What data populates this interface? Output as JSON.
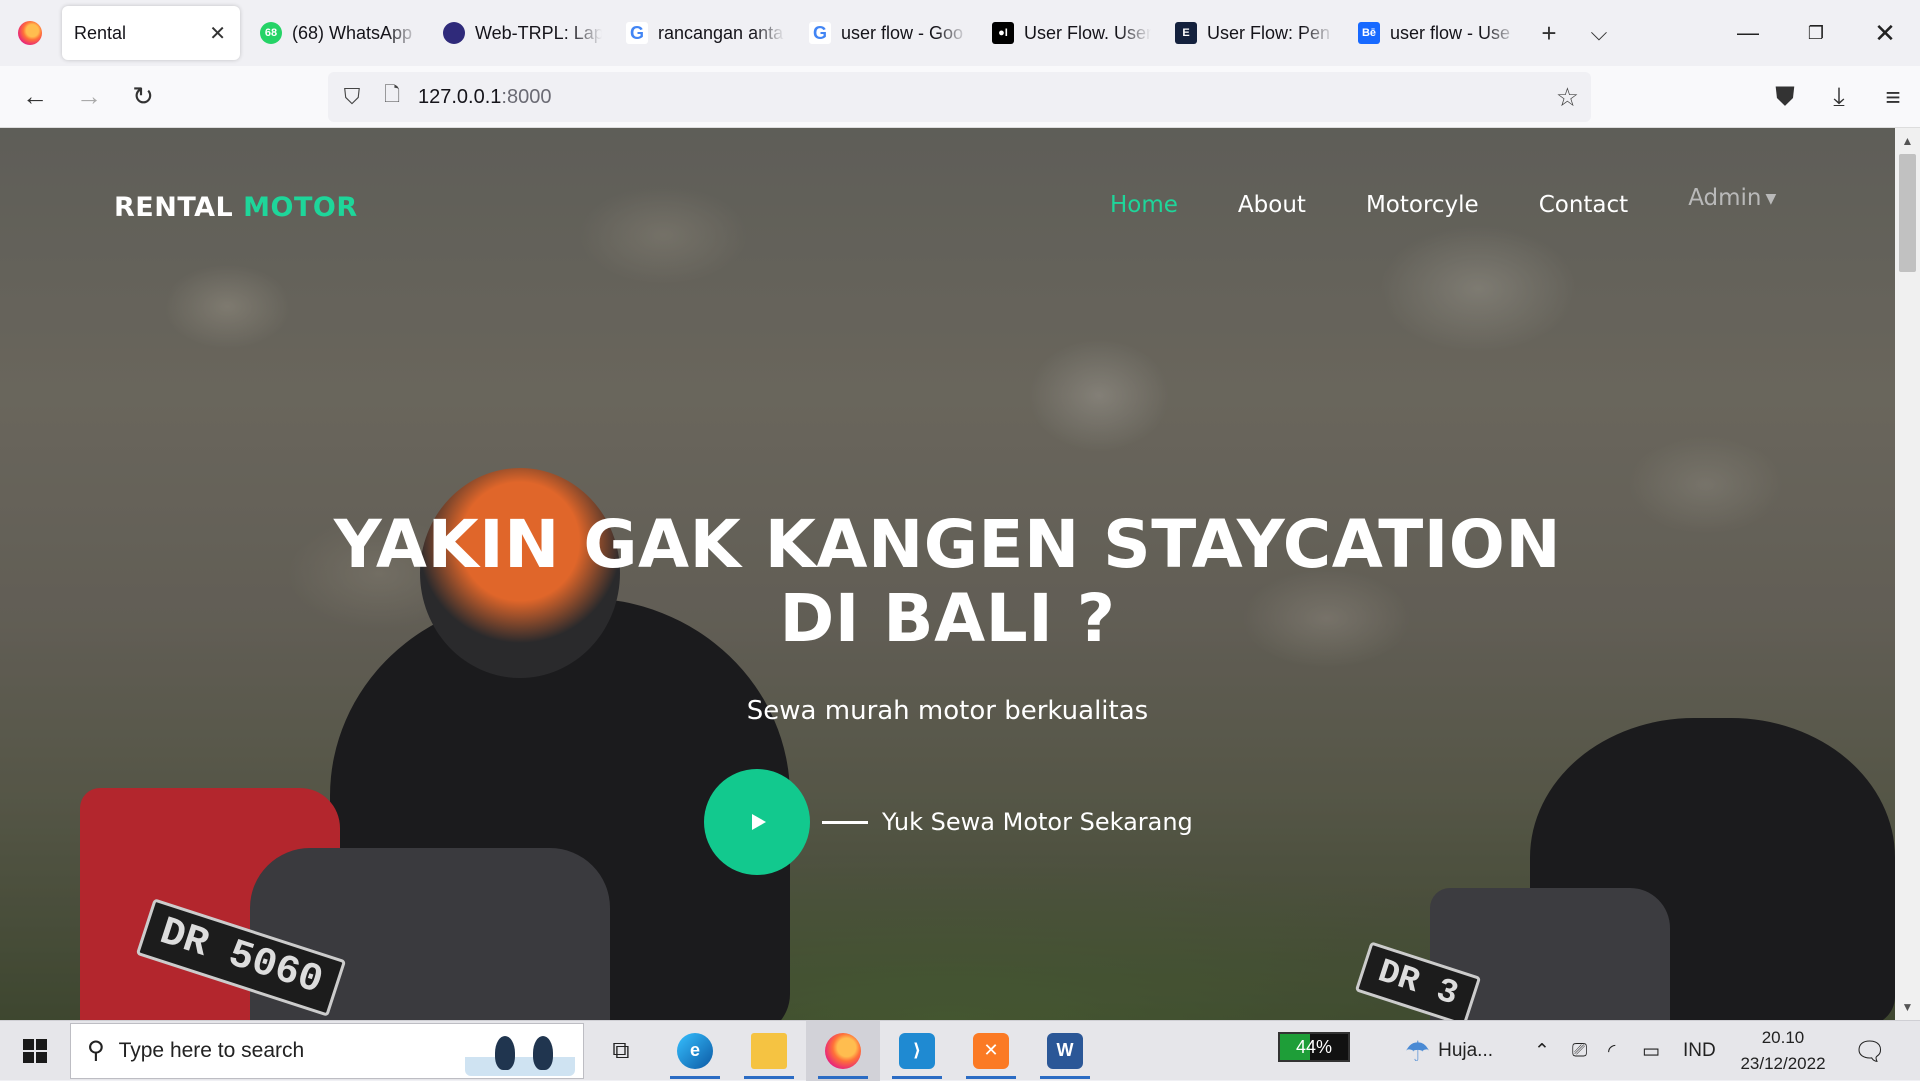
{
  "browser": {
    "tabs": [
      {
        "title": "Rental",
        "active": true,
        "favicon": "firefox-icon"
      },
      {
        "title": "(68) WhatsApp",
        "favicon_text": "68",
        "favicon_color": "#25d366"
      },
      {
        "title": "Web-TRPL: Lap",
        "favicon_text": "",
        "favicon_color": "#2f2a7a"
      },
      {
        "title": "rancangan anta",
        "favicon_text": "G",
        "favicon_color": "#4285f4"
      },
      {
        "title": "user flow - Goo",
        "favicon_text": "G",
        "favicon_color": "#4285f4"
      },
      {
        "title": "User Flow. User",
        "favicon_text": "M",
        "favicon_color": "#000000"
      },
      {
        "title": "User Flow: Pen",
        "favicon_text": "E",
        "favicon_color": "#14213d"
      },
      {
        "title": "user flow - Use",
        "favicon_text": "Bē",
        "favicon_color": "#1769ff"
      }
    ],
    "new_tab_icon": "plus-icon",
    "list_tabs_icon": "chevron-down-icon",
    "window_controls": [
      "minimize-icon",
      "restore-icon",
      "close-icon"
    ],
    "url_host": "127.0.0.1",
    "url_port": ":8000"
  },
  "site": {
    "brand_main": "RENTAL",
    "brand_accent": "MOTOR",
    "accent_color": "#1ed69a",
    "nav": {
      "home": "Home",
      "about": "About",
      "motorcycle": "Motorcyle",
      "contact": "Contact",
      "admin": "Admin"
    },
    "hero": {
      "title_line1": "YAKIN GAK KANGEN STAYCATION",
      "title_line2": "DI BALI ?",
      "subtitle": "Sewa murah motor berkualitas",
      "cta_label": "Yuk Sewa Motor Sekarang",
      "play_color": "#12c98e"
    },
    "plate_left": "DR 5060",
    "plate_right": "DR 3"
  },
  "taskbar": {
    "search_placeholder": "Type here to search",
    "apps": [
      "task-view-icon",
      "edge-icon",
      "file-explorer-icon",
      "firefox-icon",
      "vscode-icon",
      "xampp-icon",
      "word-icon"
    ],
    "battery_percent": "44%",
    "battery_level": 0.44,
    "weather": "Huja...",
    "language": "IND",
    "time": "20.10",
    "date": "23/12/2022"
  }
}
